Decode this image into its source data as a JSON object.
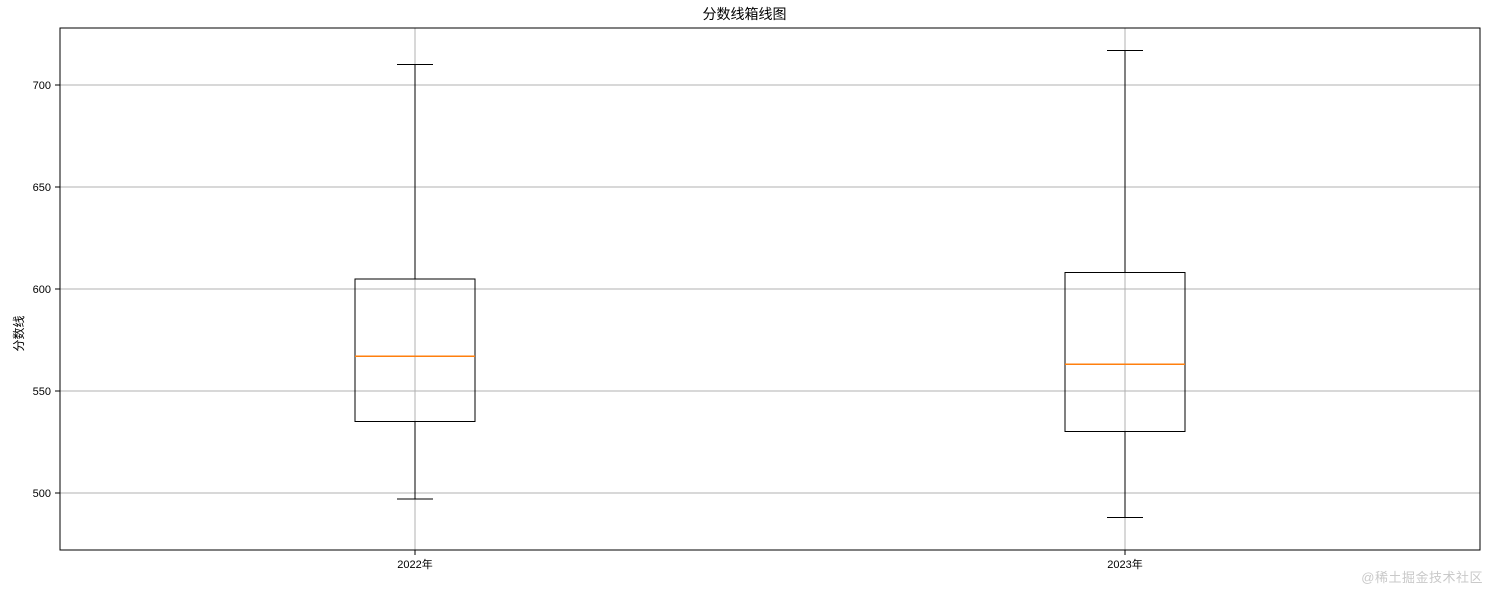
{
  "chart_data": {
    "type": "boxplot",
    "title": "分数线箱线图",
    "ylabel": "分数线",
    "xlabel": "",
    "categories": [
      "2022年",
      "2023年"
    ],
    "yticks": [
      500,
      550,
      600,
      650,
      700
    ],
    "ylim": [
      472,
      728
    ],
    "series": [
      {
        "name": "2022年",
        "min": 497,
        "q1": 535,
        "median": 567,
        "q3": 605,
        "max": 710
      },
      {
        "name": "2023年",
        "min": 488,
        "q1": 530,
        "median": 563,
        "q3": 608,
        "max": 717
      }
    ]
  },
  "watermark": "@稀土掘金技术社区"
}
